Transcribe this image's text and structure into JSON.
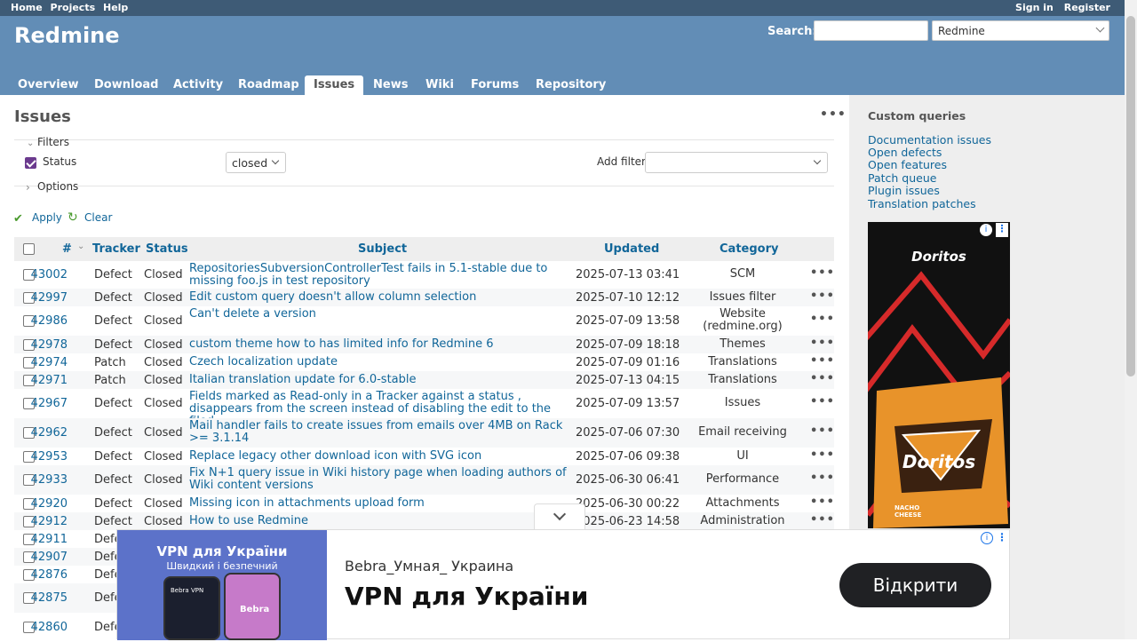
{
  "top_menu": {
    "left": [
      "Home",
      "Projects",
      "Help"
    ],
    "right": [
      "Sign in",
      "Register"
    ]
  },
  "header": {
    "title": "Redmine",
    "search_label": "Search:",
    "search_value": "",
    "project_select": "Redmine"
  },
  "tabs": [
    "Overview",
    "Download",
    "Activity",
    "Roadmap",
    "Issues",
    "News",
    "Wiki",
    "Forums",
    "Repository"
  ],
  "selected_tab": "Issues",
  "content": {
    "title": "Issues",
    "filters_label": "Filters",
    "status_label": "Status",
    "status_value": "closed",
    "add_filter_label": "Add filter",
    "options_label": "Options",
    "apply_label": "Apply",
    "clear_label": "Clear"
  },
  "table": {
    "headers": {
      "id": "#",
      "tracker": "Tracker",
      "status": "Status",
      "subject": "Subject",
      "updated": "Updated",
      "category": "Category"
    },
    "rows": [
      {
        "id": "43002",
        "tracker": "Defect",
        "status": "Closed",
        "subject": "RepositoriesSubversionControllerTest fails in 5.1-stable due to missing foo.js in test repository",
        "updated": "2025-07-13 03:41",
        "category": "SCM"
      },
      {
        "id": "42997",
        "tracker": "Defect",
        "status": "Closed",
        "subject": "Edit custom query doesn't allow column selection",
        "updated": "2025-07-10 12:12",
        "category": "Issues filter"
      },
      {
        "id": "42986",
        "tracker": "Defect",
        "status": "Closed",
        "subject": "Can't delete a version",
        "updated": "2025-07-09 13:58",
        "category": "Website (redmine.org)"
      },
      {
        "id": "42978",
        "tracker": "Defect",
        "status": "Closed",
        "subject": "custom theme how to has limited info for Redmine 6",
        "updated": "2025-07-09 18:18",
        "category": "Themes"
      },
      {
        "id": "42974",
        "tracker": "Patch",
        "status": "Closed",
        "subject": "Czech localization update",
        "updated": "2025-07-09 01:16",
        "category": "Translations"
      },
      {
        "id": "42971",
        "tracker": "Patch",
        "status": "Closed",
        "subject": "Italian translation update for 6.0-stable",
        "updated": "2025-07-13 04:15",
        "category": "Translations"
      },
      {
        "id": "42967",
        "tracker": "Defect",
        "status": "Closed",
        "subject": "Fields marked as Read-only in a Tracker against a status , disappears from the screen instead of disabling the edit to the filed",
        "updated": "2025-07-09 13:57",
        "category": "Issues"
      },
      {
        "id": "42962",
        "tracker": "Defect",
        "status": "Closed",
        "subject": "Mail handler fails to create issues from emails over 4MB on Rack >= 3.1.14",
        "updated": "2025-07-06 07:30",
        "category": "Email receiving"
      },
      {
        "id": "42953",
        "tracker": "Defect",
        "status": "Closed",
        "subject": "Replace legacy other download icon with SVG icon",
        "updated": "2025-07-06 09:38",
        "category": "UI"
      },
      {
        "id": "42933",
        "tracker": "Defect",
        "status": "Closed",
        "subject": "Fix N+1 query issue in Wiki history page when loading authors of Wiki content versions",
        "updated": "2025-06-30 06:41",
        "category": "Performance"
      },
      {
        "id": "42920",
        "tracker": "Defect",
        "status": "Closed",
        "subject": "Missing icon in attachments upload form",
        "updated": "2025-06-30 00:22",
        "category": "Attachments"
      },
      {
        "id": "42912",
        "tracker": "Defect",
        "status": "Closed",
        "subject": "How to use Redmine",
        "updated": "2025-06-23 14:58",
        "category": "Administration"
      },
      {
        "id": "42911",
        "tracker": "Defect",
        "status": "",
        "subject": "",
        "updated": "",
        "category": ""
      },
      {
        "id": "42907",
        "tracker": "Defect",
        "status": "",
        "subject": "",
        "updated": "",
        "category": ""
      },
      {
        "id": "42876",
        "tracker": "Defect",
        "status": "",
        "subject": "",
        "updated": "",
        "category": ""
      },
      {
        "id": "42875",
        "tracker": "Defect",
        "status": "",
        "subject": "",
        "updated": "",
        "category": ""
      },
      {
        "id": "42860",
        "tracker": "Defect",
        "status": "",
        "subject": "",
        "updated": "",
        "category": ""
      }
    ]
  },
  "sidebar": {
    "title": "Custom queries",
    "queries": [
      "Documentation issues",
      "Open defects",
      "Open features",
      "Patch queue",
      "Plugin issues",
      "Translation patches"
    ],
    "ad_brand": "Doritos",
    "ad_brand_bag": "Doritos",
    "ad_bag_text": "NACHO CHEESE"
  },
  "bottom_ad": {
    "image_title": "VPN для України",
    "image_subtitle": "Швидкий і безпечний",
    "phone1_label": "Bebra VPN",
    "phone2_label": "Bebra",
    "advertiser": "Bebra_Умная_ Украина",
    "headline": "VPN для України",
    "cta": "Відкрити"
  }
}
